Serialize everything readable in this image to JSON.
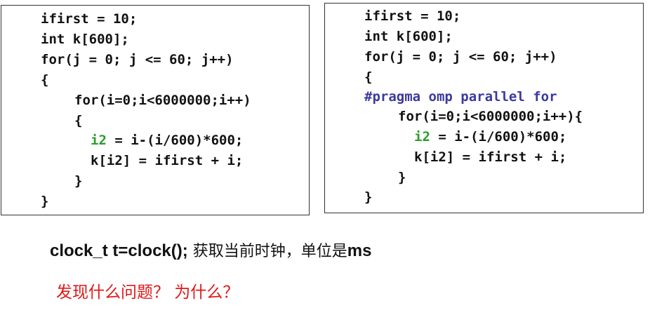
{
  "colors": {
    "code_text": "#111111",
    "green_token": "#2a9d2a",
    "pragma": "#3a3aa0",
    "question_red": "#e01818",
    "border": "#333333"
  },
  "left_code": {
    "l1": "ifirst = 10;",
    "l2": "int k[600];",
    "l3": "for(j = 0; j <= 60; j++)",
    "l4": "{",
    "l5": "for(i=0;i<6000000;i++)",
    "l6": "{",
    "l7_token": "i2",
    "l7_rest": " = i-(i/600)*600;",
    "l8": "k[i2] = ifirst + i;",
    "l9": "}",
    "l10": "}"
  },
  "right_code": {
    "l1": "ifirst = 10;",
    "l2": "int k[600];",
    "l3": "for(j = 0; j <= 60; j++)",
    "l4": "{",
    "l5": "#pragma omp parallel for",
    "l6": "for(i=0;i<6000000;i++){",
    "l7_token": "i2",
    "l7_rest": " = i-(i/600)*600;",
    "l8": "k[i2] = ifirst + i;",
    "l9": "}",
    "l10": "}"
  },
  "caption": {
    "code": "clock_t t=clock();",
    "description": " 获取当前时钟，单位是",
    "unit": "ms"
  },
  "question": "发现什么问题？ 为什么？"
}
